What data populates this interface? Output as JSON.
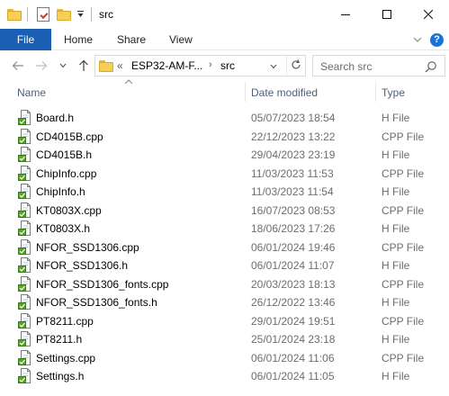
{
  "window": {
    "title": "src",
    "controls": {
      "minimize_icon": "minimize-icon",
      "maximize_icon": "maximize-icon",
      "close_icon": "close-icon"
    }
  },
  "ribbon": {
    "tabs": [
      {
        "label": "File",
        "active": true
      },
      {
        "label": "Home"
      },
      {
        "label": "Share"
      },
      {
        "label": "View"
      }
    ],
    "accent_color": "#1a5fb4"
  },
  "navigation": {
    "path": [
      {
        "label": "ESP32-AM-F..."
      },
      {
        "label": "src"
      }
    ],
    "overflow": "«",
    "search_placeholder": "Search src"
  },
  "columns": {
    "name": "Name",
    "date_modified": "Date modified",
    "type": "Type"
  },
  "files": [
    {
      "name": "Board.h",
      "date": "05/07/2023 18:54",
      "type": "H File"
    },
    {
      "name": "CD4015B.cpp",
      "date": "22/12/2023 13:22",
      "type": "CPP File"
    },
    {
      "name": "CD4015B.h",
      "date": "29/04/2023 23:19",
      "type": "H File"
    },
    {
      "name": "ChipInfo.cpp",
      "date": "11/03/2023 11:53",
      "type": "CPP File"
    },
    {
      "name": "ChipInfo.h",
      "date": "11/03/2023 11:54",
      "type": "H File"
    },
    {
      "name": "KT0803X.cpp",
      "date": "16/07/2023 08:53",
      "type": "CPP File"
    },
    {
      "name": "KT0803X.h",
      "date": "18/06/2023 17:26",
      "type": "H File"
    },
    {
      "name": "NFOR_SSD1306.cpp",
      "date": "06/01/2024 19:46",
      "type": "CPP File"
    },
    {
      "name": "NFOR_SSD1306.h",
      "date": "06/01/2024 11:07",
      "type": "H File"
    },
    {
      "name": "NFOR_SSD1306_fonts.cpp",
      "date": "20/03/2023 18:13",
      "type": "CPP File"
    },
    {
      "name": "NFOR_SSD1306_fonts.h",
      "date": "26/12/2022 13:46",
      "type": "H File"
    },
    {
      "name": "PT8211.cpp",
      "date": "29/01/2024 19:51",
      "type": "CPP File"
    },
    {
      "name": "PT8211.h",
      "date": "25/01/2024 23:18",
      "type": "H File"
    },
    {
      "name": "Settings.cpp",
      "date": "06/01/2024 11:06",
      "type": "CPP File"
    },
    {
      "name": "Settings.h",
      "date": "06/01/2024 11:05",
      "type": "H File"
    }
  ]
}
